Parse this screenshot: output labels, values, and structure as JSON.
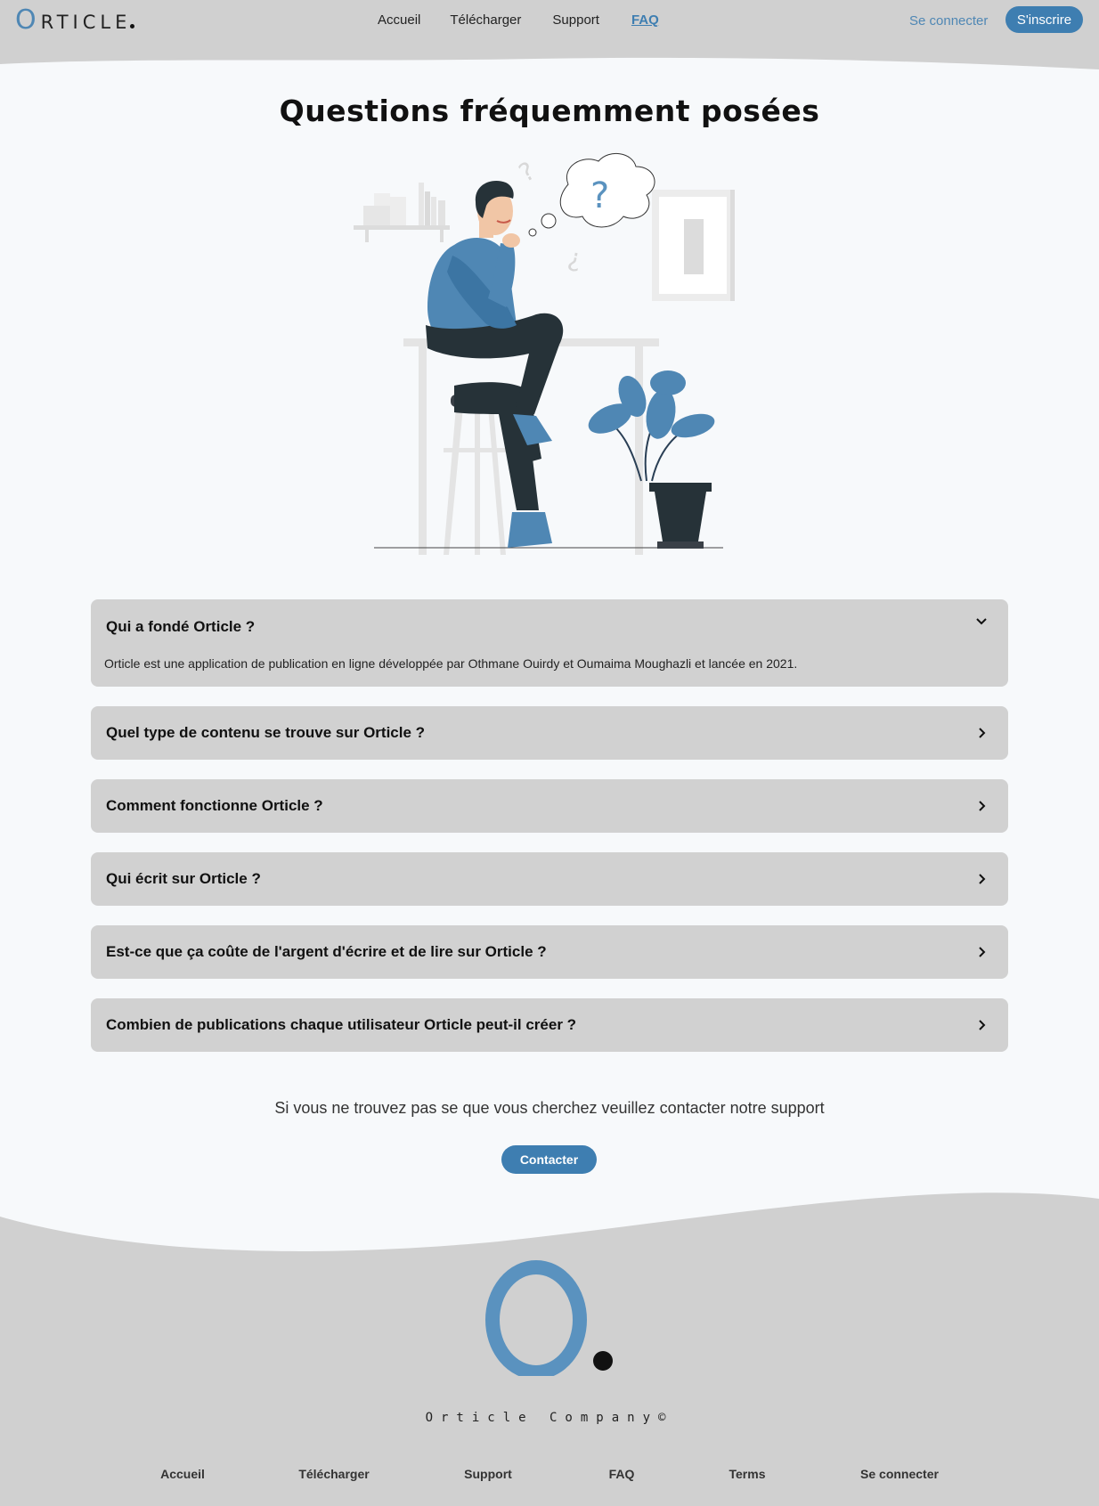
{
  "header": {
    "logo_letter": "O",
    "logo_rest": "RTICLE",
    "nav": [
      {
        "label": "Accueil"
      },
      {
        "label": "Télécharger"
      },
      {
        "label": "Support"
      },
      {
        "label": "FAQ",
        "active": true
      }
    ],
    "login_label": "Se connecter",
    "signup_label": "S'inscrire"
  },
  "main": {
    "title": "Questions fréquemment posées",
    "faq": [
      {
        "question": "Qui a fondé Orticle ?",
        "answer": "Orticle est une application de publication en ligne développée par Othmane Ouirdy et Oumaima Moughazli et lancée en 2021.",
        "open": true
      },
      {
        "question": "Quel type de contenu se trouve sur Orticle ?"
      },
      {
        "question": "Comment fonctionne Orticle ?"
      },
      {
        "question": "Qui écrit sur Orticle ?"
      },
      {
        "question": "Est-ce que ça coûte de l'argent d'écrire et de lire sur Orticle ?"
      },
      {
        "question": "Combien de publications chaque utilisateur Orticle peut-il créer ?"
      }
    ],
    "support_text": "Si vous ne trouvez pas se que vous cherchez veuillez contacter notre support",
    "contact_label": "Contacter"
  },
  "footer": {
    "company": "Orticle Company©",
    "nav": [
      {
        "label": "Accueil"
      },
      {
        "label": "Télécharger"
      },
      {
        "label": "Support"
      },
      {
        "label": "FAQ"
      },
      {
        "label": "Terms"
      },
      {
        "label": "Se connecter"
      }
    ]
  },
  "colors": {
    "accent": "#3e7eb1",
    "light_accent": "#5a92bf",
    "panel_gray": "#d1d1d1",
    "background": "#f7f9fb"
  },
  "icons": {
    "faq_open": "chevron-down-icon",
    "faq_closed": "chevron-right-icon"
  }
}
